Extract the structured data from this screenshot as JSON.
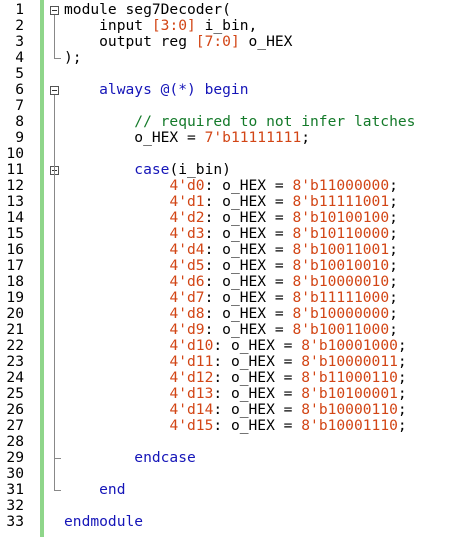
{
  "editor": {
    "lines": [
      [
        {
          "t": "module seg7Decoder(",
          "c": ""
        }
      ],
      [
        {
          "t": "    input ",
          "c": ""
        },
        {
          "t": "[3:0]",
          "c": "num"
        },
        {
          "t": " i_bin,",
          "c": ""
        }
      ],
      [
        {
          "t": "    output reg ",
          "c": ""
        },
        {
          "t": "[7:0]",
          "c": "num"
        },
        {
          "t": " o_HEX",
          "c": ""
        }
      ],
      [
        {
          "t": ");",
          "c": ""
        }
      ],
      [
        {
          "t": "",
          "c": ""
        }
      ],
      [
        {
          "t": "    always @(*) begin",
          "c": "kw"
        }
      ],
      [
        {
          "t": "",
          "c": ""
        }
      ],
      [
        {
          "t": "        // required to not infer latches",
          "c": "cm"
        }
      ],
      [
        {
          "t": "        o_HEX = ",
          "c": ""
        },
        {
          "t": "7'b11111111",
          "c": "num"
        },
        {
          "t": ";",
          "c": ""
        }
      ],
      [
        {
          "t": "",
          "c": ""
        }
      ],
      [
        {
          "t": "        case",
          "c": "kw"
        },
        {
          "t": "(i_bin)",
          "c": ""
        }
      ],
      [
        {
          "t": "            ",
          "c": ""
        },
        {
          "t": "4'd0",
          "c": "num"
        },
        {
          "t": ": o_HEX = ",
          "c": ""
        },
        {
          "t": "8'b11000000",
          "c": "num"
        },
        {
          "t": ";",
          "c": ""
        }
      ],
      [
        {
          "t": "            ",
          "c": ""
        },
        {
          "t": "4'd1",
          "c": "num"
        },
        {
          "t": ": o_HEX = ",
          "c": ""
        },
        {
          "t": "8'b11111001",
          "c": "num"
        },
        {
          "t": ";",
          "c": ""
        }
      ],
      [
        {
          "t": "            ",
          "c": ""
        },
        {
          "t": "4'd2",
          "c": "num"
        },
        {
          "t": ": o_HEX = ",
          "c": ""
        },
        {
          "t": "8'b10100100",
          "c": "num"
        },
        {
          "t": ";",
          "c": ""
        }
      ],
      [
        {
          "t": "            ",
          "c": ""
        },
        {
          "t": "4'd3",
          "c": "num"
        },
        {
          "t": ": o_HEX = ",
          "c": ""
        },
        {
          "t": "8'b10110000",
          "c": "num"
        },
        {
          "t": ";",
          "c": ""
        }
      ],
      [
        {
          "t": "            ",
          "c": ""
        },
        {
          "t": "4'd4",
          "c": "num"
        },
        {
          "t": ": o_HEX = ",
          "c": ""
        },
        {
          "t": "8'b10011001",
          "c": "num"
        },
        {
          "t": ";",
          "c": ""
        }
      ],
      [
        {
          "t": "            ",
          "c": ""
        },
        {
          "t": "4'd5",
          "c": "num"
        },
        {
          "t": ": o_HEX = ",
          "c": ""
        },
        {
          "t": "8'b10010010",
          "c": "num"
        },
        {
          "t": ";",
          "c": ""
        }
      ],
      [
        {
          "t": "            ",
          "c": ""
        },
        {
          "t": "4'd6",
          "c": "num"
        },
        {
          "t": ": o_HEX = ",
          "c": ""
        },
        {
          "t": "8'b10000010",
          "c": "num"
        },
        {
          "t": ";",
          "c": ""
        }
      ],
      [
        {
          "t": "            ",
          "c": ""
        },
        {
          "t": "4'd7",
          "c": "num"
        },
        {
          "t": ": o_HEX = ",
          "c": ""
        },
        {
          "t": "8'b11111000",
          "c": "num"
        },
        {
          "t": ";",
          "c": ""
        }
      ],
      [
        {
          "t": "            ",
          "c": ""
        },
        {
          "t": "4'd8",
          "c": "num"
        },
        {
          "t": ": o_HEX = ",
          "c": ""
        },
        {
          "t": "8'b10000000",
          "c": "num"
        },
        {
          "t": ";",
          "c": ""
        }
      ],
      [
        {
          "t": "            ",
          "c": ""
        },
        {
          "t": "4'd9",
          "c": "num"
        },
        {
          "t": ": o_HEX = ",
          "c": ""
        },
        {
          "t": "8'b10011000",
          "c": "num"
        },
        {
          "t": ";",
          "c": ""
        }
      ],
      [
        {
          "t": "            ",
          "c": ""
        },
        {
          "t": "4'd10",
          "c": "num"
        },
        {
          "t": ": o_HEX = ",
          "c": ""
        },
        {
          "t": "8'b10001000",
          "c": "num"
        },
        {
          "t": ";",
          "c": ""
        }
      ],
      [
        {
          "t": "            ",
          "c": ""
        },
        {
          "t": "4'd11",
          "c": "num"
        },
        {
          "t": ": o_HEX = ",
          "c": ""
        },
        {
          "t": "8'b10000011",
          "c": "num"
        },
        {
          "t": ";",
          "c": ""
        }
      ],
      [
        {
          "t": "            ",
          "c": ""
        },
        {
          "t": "4'd12",
          "c": "num"
        },
        {
          "t": ": o_HEX = ",
          "c": ""
        },
        {
          "t": "8'b11000110",
          "c": "num"
        },
        {
          "t": ";",
          "c": ""
        }
      ],
      [
        {
          "t": "            ",
          "c": ""
        },
        {
          "t": "4'd13",
          "c": "num"
        },
        {
          "t": ": o_HEX = ",
          "c": ""
        },
        {
          "t": "8'b10100001",
          "c": "num"
        },
        {
          "t": ";",
          "c": ""
        }
      ],
      [
        {
          "t": "            ",
          "c": ""
        },
        {
          "t": "4'd14",
          "c": "num"
        },
        {
          "t": ": o_HEX = ",
          "c": ""
        },
        {
          "t": "8'b10000110",
          "c": "num"
        },
        {
          "t": ";",
          "c": ""
        }
      ],
      [
        {
          "t": "            ",
          "c": ""
        },
        {
          "t": "4'd15",
          "c": "num"
        },
        {
          "t": ": o_HEX = ",
          "c": ""
        },
        {
          "t": "8'b10001110",
          "c": "num"
        },
        {
          "t": ";",
          "c": ""
        }
      ],
      [
        {
          "t": "",
          "c": ""
        }
      ],
      [
        {
          "t": "        endcase",
          "c": "kw"
        }
      ],
      [
        {
          "t": "",
          "c": ""
        }
      ],
      [
        {
          "t": "    end",
          "c": "kw"
        }
      ],
      [
        {
          "t": "",
          "c": ""
        }
      ],
      [
        {
          "t": "endmodule",
          "c": "kw"
        }
      ]
    ],
    "fold_markers": [
      1,
      6,
      11
    ],
    "colors": {
      "keyword": "#1515b8",
      "comment": "#147a2a",
      "number": "#d24515",
      "change_bar": "#8fd68a"
    }
  }
}
